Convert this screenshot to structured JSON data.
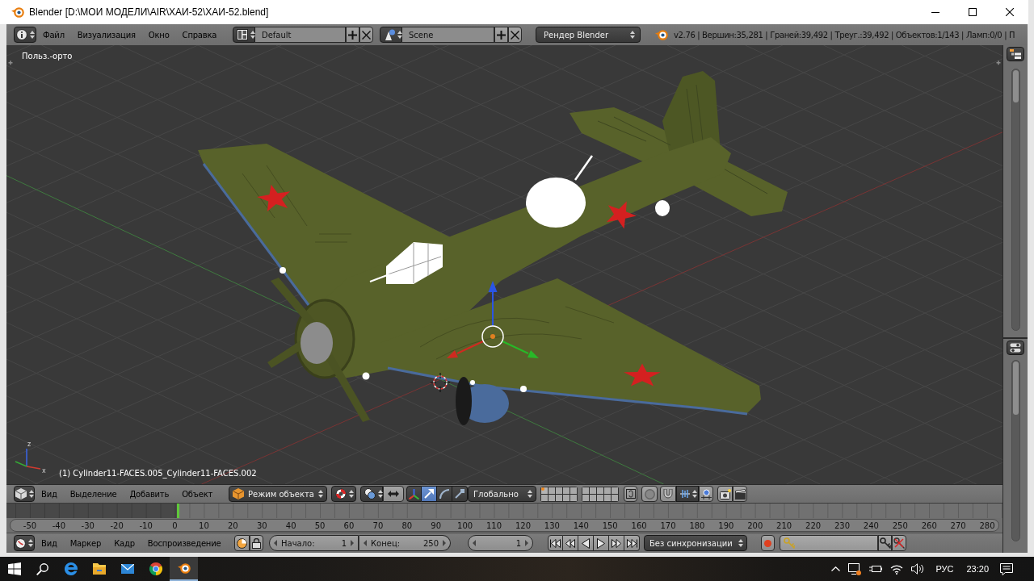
{
  "window": {
    "title": "Blender [D:\\МОИ МОДЕЛИ\\AIR\\ХАИ-52\\ХАИ-52.blend]"
  },
  "info_header": {
    "menus": [
      "Файл",
      "Визуализация",
      "Окно",
      "Справка"
    ],
    "screen_layout": "Default",
    "scene": "Scene",
    "render_engine": "Рендер Blender",
    "stats": "v2.76 | Вершин:35,281 | Граней:39,492 | Треуг.:39,492 | Объектов:1/143 | Ламп:0/0 | П"
  },
  "viewport": {
    "view_name": "Польз.-орто",
    "object_info": "(1) Cylinder11-FACES.005_Cylinder11-FACES.002",
    "axis_labels": [
      "z",
      "x"
    ]
  },
  "view3d_header": {
    "menus": [
      "Вид",
      "Выделение",
      "Добавить",
      "Объект"
    ],
    "mode": "Режим объекта",
    "transform_tools": [
      {
        "kind": "translate",
        "selected": true
      },
      {
        "kind": "rotate",
        "selected": false
      },
      {
        "kind": "scale",
        "selected": false
      }
    ],
    "orientation": "Глобально",
    "layers": [
      {
        "has_active_object": true
      },
      {
        "has_active_object": false
      },
      {
        "has_active_object": false
      },
      {
        "has_active_object": false
      },
      {
        "has_active_object": false
      },
      {
        "has_active_object": false
      },
      {
        "has_active_object": false
      },
      {
        "has_active_object": false
      },
      {
        "has_active_object": false
      },
      {
        "has_active_object": false
      },
      {
        "has_active_object": false
      },
      {
        "has_active_object": false
      },
      {
        "has_active_object": false
      },
      {
        "has_active_object": false
      },
      {
        "has_active_object": false
      },
      {
        "has_active_object": false
      },
      {
        "has_active_object": false
      },
      {
        "has_active_object": false
      },
      {
        "has_active_object": false
      },
      {
        "has_active_object": false
      }
    ]
  },
  "timeline": {
    "frame_numbers": [
      "-50",
      "-40",
      "-30",
      "-20",
      "-10",
      "0",
      "10",
      "20",
      "30",
      "40",
      "50",
      "60",
      "70",
      "80",
      "90",
      "100",
      "110",
      "120",
      "130",
      "140",
      "150",
      "160",
      "170",
      "180",
      "190",
      "200",
      "210",
      "220",
      "230",
      "240",
      "250",
      "260",
      "270",
      "280"
    ]
  },
  "timeline_header": {
    "menus": [
      "Вид",
      "Маркер",
      "Кадр",
      "Воспроизведение"
    ],
    "start_label": "Начало:",
    "start": "1",
    "end_label": "Конец:",
    "end": "250",
    "current_frame": "1",
    "sync": "Без синхронизации"
  },
  "taskbar": {
    "apps": [
      {
        "kind": "edge",
        "selected": false
      },
      {
        "kind": "explorer",
        "selected": false
      },
      {
        "kind": "mail",
        "selected": false
      },
      {
        "kind": "chrome",
        "selected": false
      },
      {
        "kind": "blender",
        "selected": true
      }
    ],
    "language": "РУС",
    "time": "23:20"
  }
}
